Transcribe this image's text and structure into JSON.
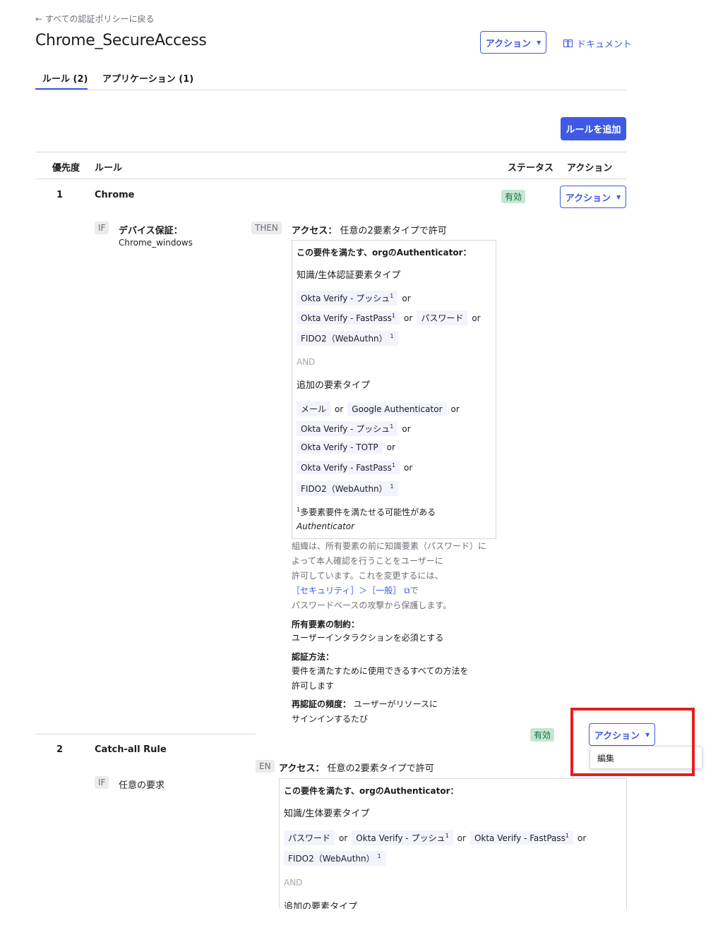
{
  "header": {
    "back_link": "← すべての認証ポリシーに戻る",
    "title": "Chrome_SecureAccess",
    "actions_button": "アクション",
    "documents_link": "ドキュメント"
  },
  "tabs": [
    {
      "label": "ルール (2)",
      "active": true
    },
    {
      "label": "アプリケーション (1)",
      "active": false
    }
  ],
  "add_rule_button": "ルールを追加",
  "table": {
    "headers": {
      "priority": "優先度",
      "rule": "ルール",
      "status": "ステータス",
      "actions": "アクション"
    }
  },
  "rules": [
    {
      "priority": "1",
      "name": "Chrome",
      "status": "有効",
      "actions_button": "アクション",
      "if_tag": "IF",
      "condition_label": "デバイス保証：",
      "condition_value": "Chrome_windows",
      "then_tag": "THEN",
      "access_label": "アクセス：",
      "access_value": "任意の2要素タイプで許可",
      "box": {
        "title": "この要件を満たす、orgのAuthenticator：",
        "section1_label": "知識/生体認証要素タイプ",
        "section1_rows": [
          [
            {
              "chip": "Okta Verify - プッシュ",
              "sup": "1"
            },
            {
              "or": "or"
            }
          ],
          [
            {
              "chip": "Okta Verify - FastPass",
              "sup": "1"
            },
            {
              "or": "or"
            },
            {
              "chip": "パスワード"
            },
            {
              "or": "or"
            }
          ],
          [
            {
              "chip": "FIDO2（WebAuthn）",
              "sup": "1"
            }
          ]
        ],
        "and_label": "AND",
        "section2_label": "追加の要素タイプ",
        "section2_rows": [
          [
            {
              "chip": "メール"
            },
            {
              "or": "or"
            },
            {
              "chip": "Google Authenticator"
            },
            {
              "or": "or"
            }
          ],
          [
            {
              "chip": "Okta Verify - プッシュ",
              "sup": "1"
            },
            {
              "or": "or"
            }
          ],
          [
            {
              "chip": "Okta Verify - TOTP"
            },
            {
              "or": "or"
            }
          ],
          [
            {
              "chip": "Okta Verify - FastPass",
              "sup": "1"
            },
            {
              "or": "or"
            }
          ],
          [
            {
              "chip": "FIDO2（WebAuthn）",
              "sup": "1"
            }
          ]
        ],
        "footnote_mark": "1",
        "footnote_line1": "多要素要件を満たせる可能性がある",
        "footnote_line2": "Authenticator"
      },
      "note": {
        "line1": "組織は、所有要素の前に知識要素（パスワード）に",
        "line2": "よって本人確認を行うことをユーザーに",
        "line3": "許可しています。これを変更するには、",
        "link": "［セキュリティ］＞［一般］",
        "link_suffix": "で",
        "line5": "パスワードベースの攻撃から保護します。"
      },
      "possession_label": "所有要素の制約：",
      "possession_value": "ユーザーインタラクションを必須とする",
      "auth_method_label": "認証方法：",
      "auth_method_line1": "要件を満たすために使用できるすべての方法を",
      "auth_method_line2": "許可します",
      "reauth_label": "再認証の頻度：",
      "reauth_value_line1": "ユーザーがリソースに",
      "reauth_value_line2": "サインインするたび"
    },
    {
      "priority": "2",
      "name": "Catch-all Rule",
      "status": "有効",
      "actions_button": "アクション",
      "if_tag": "IF",
      "condition_value": "任意の要求",
      "then_tag": "EN",
      "access_label": "アクセス：",
      "access_value": "任意の2要素タイプで許可",
      "box": {
        "title": "この要件を満たす、orgのAuthenticator：",
        "section1_label": "知識/生体要素タイプ",
        "section1_rows": [
          [
            {
              "chip": "パスワード"
            },
            {
              "or": "or"
            },
            {
              "chip": "Okta Verify - プッシュ",
              "sup": "1"
            },
            {
              "or": "or"
            },
            {
              "chip": "Okta Verify - FastPass",
              "sup": "1"
            },
            {
              "or": "or"
            }
          ],
          [
            {
              "chip": "FIDO2（WebAuthn）",
              "sup": "1"
            }
          ]
        ],
        "and_label": "AND",
        "section2_label": "追加の要素タイプ"
      }
    }
  ],
  "dropdown": {
    "items": [
      "編集"
    ]
  },
  "colors": {
    "accent": "#3f59e4",
    "active_badge_bg": "#c4e7d3",
    "highlight": "#e61e1e"
  }
}
